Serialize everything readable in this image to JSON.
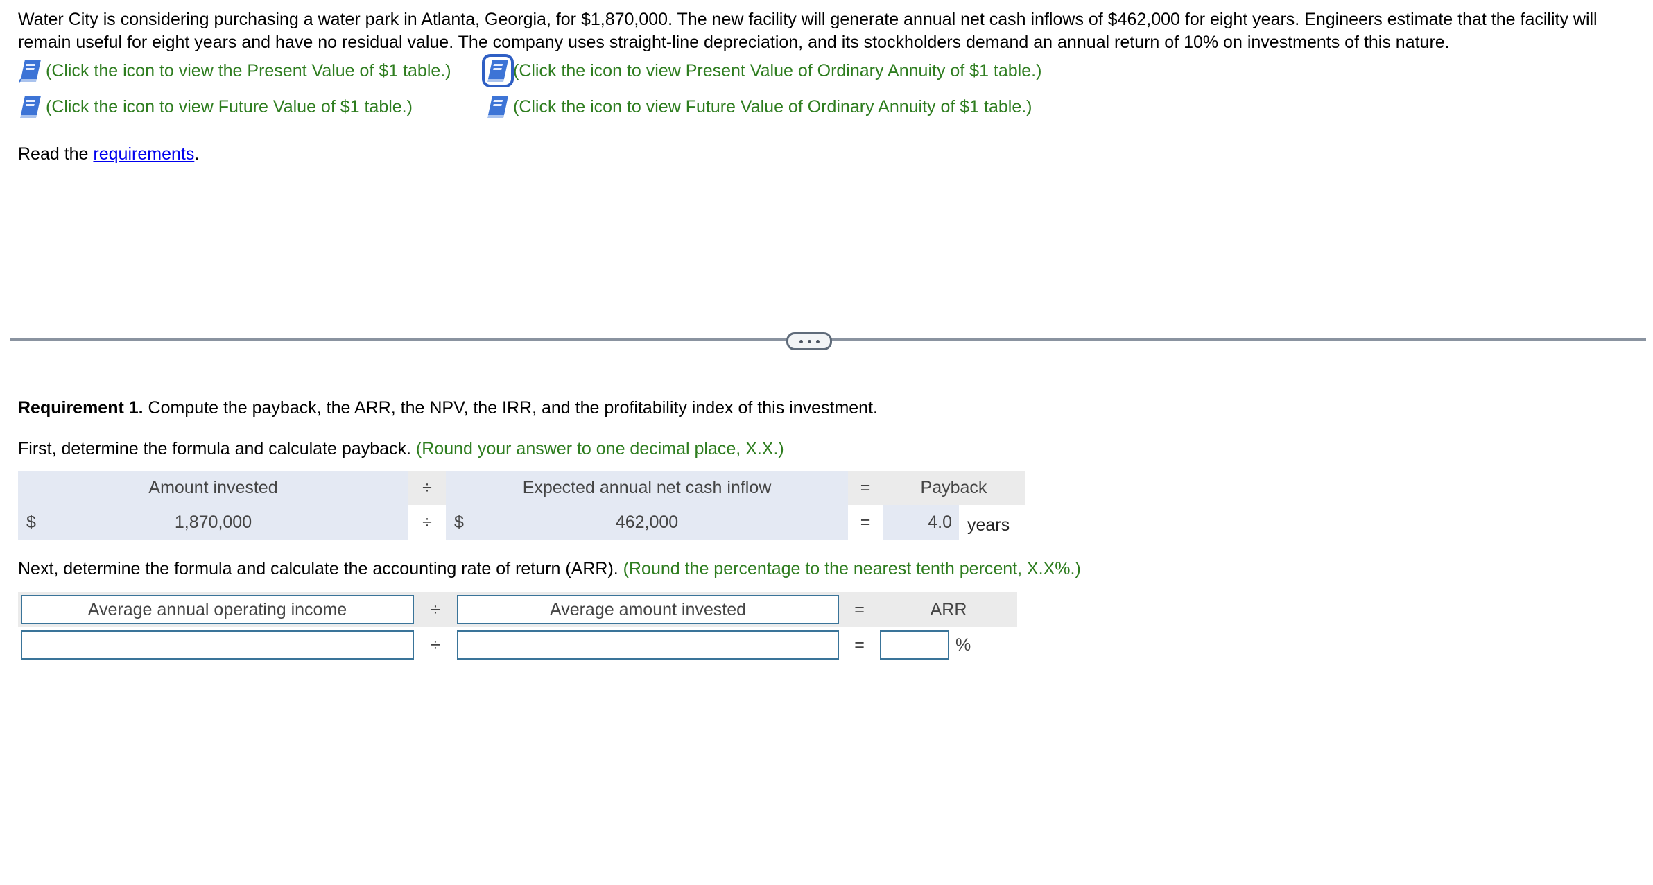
{
  "problem": {
    "text": "Water City is considering purchasing a water park in Atlanta, Georgia, for $1,870,000. The new facility will generate annual net cash inflows of $462,000 for eight years. Engineers estimate that the facility will remain useful for eight years and have no residual value. The company uses straight-line depreciation, and its stockholders demand an annual return of 10% on investments of this nature."
  },
  "table_links": [
    {
      "label": "(Click the icon to view the Present Value of $1 table.)",
      "icon": "book-icon"
    },
    {
      "label": "(Click the icon to view Present Value of Ordinary Annuity of $1 table.)",
      "icon": "book-icon"
    },
    {
      "label": "(Click the icon to view Future Value of $1 table.)",
      "icon": "book-icon"
    },
    {
      "label": "(Click the icon to view Future Value of Ordinary Annuity of $1 table.)",
      "icon": "book-icon"
    }
  ],
  "read_requirements": {
    "prefix": "Read the ",
    "link": "requirements",
    "suffix": "."
  },
  "divider": {
    "button_icon": "ellipsis-icon"
  },
  "requirement1": {
    "title_bold": "Requirement 1.",
    "title_rest": " Compute the payback, the ARR, the NPV, the IRR, and the profitability index of this investment.",
    "payback_instruction": "First, determine the formula and calculate payback.",
    "payback_hint": "(Round your answer to one decimal place, X.X.)",
    "payback_table": {
      "header": {
        "amount_invested": "Amount invested",
        "divide": "÷",
        "expected_inflow": "Expected annual net cash inflow",
        "equals": "=",
        "payback": "Payback"
      },
      "row": {
        "currency1": "$",
        "amount_invested": "1,870,000",
        "divide": "÷",
        "currency2": "$",
        "expected_inflow": "462,000",
        "equals": "=",
        "payback": "4.0",
        "unit": "years"
      }
    },
    "arr_instruction": "Next, determine the formula and calculate the accounting rate of return (ARR).",
    "arr_hint": "(Round the percentage to the nearest tenth percent, X.X%.)",
    "arr_table": {
      "header": {
        "numerator": "Average annual operating income",
        "divide": "÷",
        "denominator": "Average amount invested",
        "equals": "=",
        "result": "ARR"
      },
      "row": {
        "numerator_value": "",
        "divide": "÷",
        "denominator_value": "",
        "equals": "=",
        "result_value": "",
        "unit": "%"
      }
    }
  }
}
